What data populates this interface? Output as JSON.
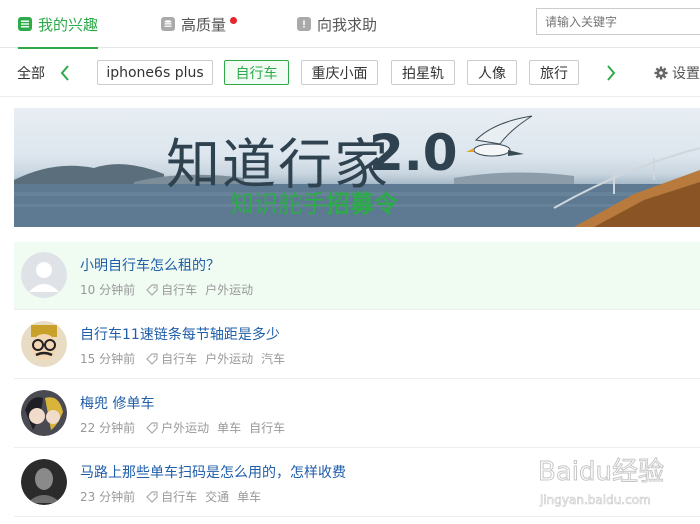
{
  "tabs": [
    {
      "label": "我的兴趣",
      "active": true
    },
    {
      "label": "高质量",
      "has_dot": true
    },
    {
      "label": "向我求助"
    }
  ],
  "search": {
    "placeholder": "请输入关键字"
  },
  "tagbar": {
    "all_label": "全部",
    "tags": [
      "iphone6s plus",
      "自行车",
      "重庆小面",
      "拍星轨",
      "人像",
      "旅行"
    ],
    "selected": "自行车",
    "settings_label": "设置"
  },
  "banner": {
    "title": "知道行家",
    "version": "2.0",
    "subtitle_plain": "知识舵手",
    "subtitle_bold": "招募令"
  },
  "feed": [
    {
      "title": "小明自行车怎么租的？",
      "time": "10 分钟前",
      "tags": [
        "自行车",
        "户外运动"
      ],
      "avatar": "default-avatar"
    },
    {
      "title": "自行车11速链条每节轴距是多少",
      "time": "15 分钟前",
      "tags": [
        "自行车",
        "户外运动",
        "汽车"
      ],
      "avatar": "cartoon-avatar"
    },
    {
      "title": "梅兜 修单车",
      "time": "22 分钟前",
      "tags": [
        "户外运动",
        "单车",
        "自行车"
      ],
      "avatar": "anime-avatar"
    },
    {
      "title": "马路上那些单车扫码是怎么用的，怎样收费",
      "time": "23 分钟前",
      "tags": [
        "自行车",
        "交通",
        "单车"
      ],
      "avatar": "photo-avatar"
    }
  ],
  "watermark": {
    "brand": "Baidu经验",
    "url": "jingyan.baidu.com"
  },
  "colors": {
    "accent": "#2eaa4b",
    "link": "#1f5ea8",
    "highlight": "#f0fbf2",
    "dot": "#e5262c"
  }
}
